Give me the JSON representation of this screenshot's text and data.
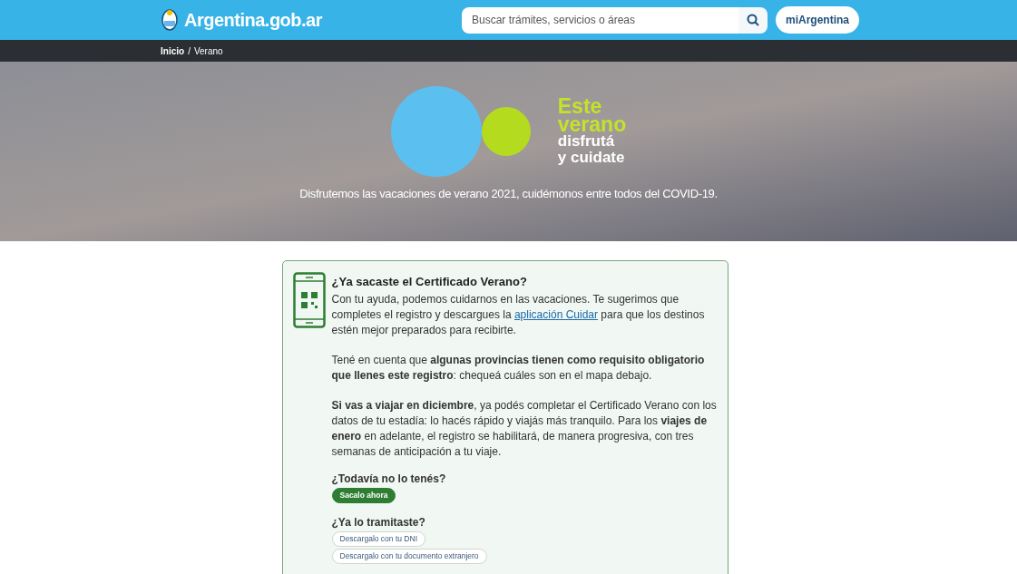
{
  "header": {
    "logo": "Argentina.gob.ar",
    "search": {
      "placeholder": "Buscar trámites, servicios o áreas"
    },
    "account_button": "miArgentina"
  },
  "breadcrumb": {
    "separator": "/",
    "items": [
      {
        "label": "Inicio"
      },
      {
        "label": "Verano"
      }
    ]
  },
  "hero": {
    "slogan_top": [
      "Este",
      "verano"
    ],
    "slogan_bottom": [
      "disfrutá",
      "y cuidate"
    ],
    "caption": "Disfrutemos las vacaciones de verano 2021, cuidémonos entre todos del COVID-19."
  },
  "card": {
    "title": "¿Ya sacaste el Certificado Verano?",
    "intro": {
      "before": "Con tu ayuda, podemos cuidarnos en las vacaciones. Te sugerimos que completes el registro y descargues la",
      "link": "aplicación Cuidar",
      "after": "para que los destinos estén mejor preparados para recibirte."
    },
    "paragraphs": [
      "Tené en cuenta que **algunas provincias tienen como requisito obligatorio que llenes este registro**: chequeá cuáles son en el mapa debajo.",
      "**Si vas a viajar en diciembre**, ya podés completar el Certificado Verano con los datos de tu estadía: lo hacés rápido y viajás más tranquilo. Para los **viajes de enero** en adelante, el registro se habilitará, de manera progresiva, con tres semanas de anticipación a tu viaje."
    ],
    "sections": [
      {
        "heading": "¿Todavía no lo tenés?",
        "buttons": [
          {
            "label": "Sacalo ahora",
            "kind": "primary"
          }
        ]
      },
      {
        "heading": "¿Ya lo tramitaste?",
        "buttons": [
          {
            "label": "Descargalo con tu DNI",
            "kind": "outline"
          },
          {
            "label": "Descargalo con tu documento extranjero",
            "kind": "outline"
          }
        ]
      }
    ]
  }
}
